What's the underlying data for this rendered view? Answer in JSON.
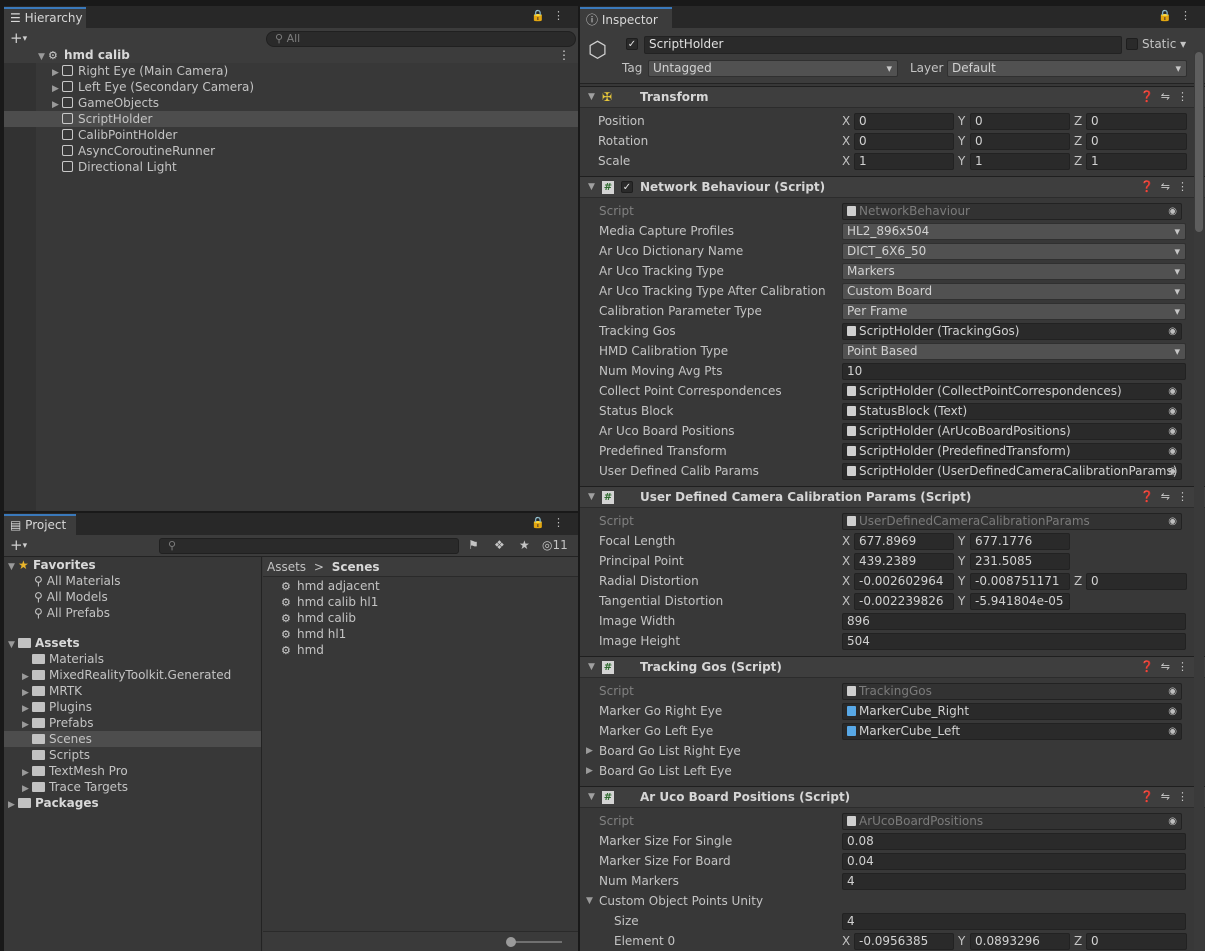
{
  "hierarchy": {
    "tab_label": "Hierarchy",
    "search_placeholder": "All",
    "scene_name": "hmd calib",
    "items": [
      {
        "label": "Right Eye (Main Camera)",
        "expandable": true
      },
      {
        "label": "Left Eye (Secondary Camera)",
        "expandable": true
      },
      {
        "label": "GameObjects",
        "expandable": true
      },
      {
        "label": "ScriptHolder",
        "expandable": false,
        "selected": true
      },
      {
        "label": "CalibPointHolder",
        "expandable": false
      },
      {
        "label": "AsyncCoroutineRunner",
        "expandable": false
      },
      {
        "label": "Directional Light",
        "expandable": false
      }
    ]
  },
  "project": {
    "tab_label": "Project",
    "hidden_count": "11",
    "favorites_label": "Favorites",
    "favorites": [
      "All Materials",
      "All Models",
      "All Prefabs"
    ],
    "assets_label": "Assets",
    "assets": [
      {
        "label": "Materials",
        "expandable": false
      },
      {
        "label": "MixedRealityToolkit.Generated",
        "expandable": true
      },
      {
        "label": "MRTK",
        "expandable": true
      },
      {
        "label": "Plugins",
        "expandable": true
      },
      {
        "label": "Prefabs",
        "expandable": true
      },
      {
        "label": "Scenes",
        "expandable": false,
        "selected": true
      },
      {
        "label": "Scripts",
        "expandable": false
      },
      {
        "label": "TextMesh Pro",
        "expandable": true
      },
      {
        "label": "Trace Targets",
        "expandable": true
      }
    ],
    "packages_label": "Packages",
    "breadcrumb": {
      "root": "Assets",
      "sep": ">",
      "current": "Scenes"
    },
    "files": [
      "hmd adjacent",
      "hmd calib hl1",
      "hmd calib",
      "hmd hl1",
      "hmd"
    ]
  },
  "inspector": {
    "tab_label": "Inspector",
    "object_name": "ScriptHolder",
    "static_label": "Static",
    "tag_label": "Tag",
    "tag_value": "Untagged",
    "layer_label": "Layer",
    "layer_value": "Default",
    "transform": {
      "title": "Transform",
      "rows": [
        {
          "label": "Position",
          "x": "0",
          "y": "0",
          "z": "0"
        },
        {
          "label": "Rotation",
          "x": "0",
          "y": "0",
          "z": "0"
        },
        {
          "label": "Scale",
          "x": "1",
          "y": "1",
          "z": "1"
        }
      ]
    },
    "network": {
      "title": "Network Behaviour (Script)",
      "rows": [
        {
          "label": "Script",
          "value": "NetworkBehaviour",
          "kind": "script"
        },
        {
          "label": "Media Capture Profiles",
          "value": "HL2_896x504",
          "kind": "dropdown"
        },
        {
          "label": "Ar Uco Dictionary Name",
          "value": "DICT_6X6_50",
          "kind": "dropdown"
        },
        {
          "label": "Ar Uco Tracking Type",
          "value": "Markers",
          "kind": "dropdown"
        },
        {
          "label": "Ar Uco Tracking Type After Calibration",
          "value": "Custom Board",
          "kind": "dropdown"
        },
        {
          "label": "Calibration Parameter Type",
          "value": "Per Frame",
          "kind": "dropdown"
        },
        {
          "label": "Tracking Gos",
          "value": "ScriptHolder (TrackingGos)",
          "kind": "object"
        },
        {
          "label": "HMD Calibration Type",
          "value": "Point Based",
          "kind": "dropdown"
        },
        {
          "label": "Num Moving Avg Pts",
          "value": "10",
          "kind": "text"
        },
        {
          "label": "Collect Point Correspondences",
          "value": "ScriptHolder (CollectPointCorrespondences)",
          "kind": "object"
        },
        {
          "label": "Status Block",
          "value": "StatusBlock (Text)",
          "kind": "object-text"
        },
        {
          "label": "Ar Uco Board Positions",
          "value": "ScriptHolder (ArUcoBoardPositions)",
          "kind": "object"
        },
        {
          "label": "Predefined Transform",
          "value": "ScriptHolder (PredefinedTransform)",
          "kind": "object"
        },
        {
          "label": "User Defined Calib Params",
          "value": "ScriptHolder (UserDefinedCameraCalibrationParams)",
          "kind": "object"
        }
      ]
    },
    "calib": {
      "title": "User Defined Camera Calibration Params (Script)",
      "script_label": "Script",
      "script_value": "UserDefinedCameraCalibrationParams",
      "focal": {
        "label": "Focal Length",
        "x": "677.8969",
        "y": "677.1776"
      },
      "principal": {
        "label": "Principal Point",
        "x": "439.2389",
        "y": "231.5085"
      },
      "radial": {
        "label": "Radial Distortion",
        "x": "-0.002602964",
        "y": "-0.008751171",
        "z": "0"
      },
      "tangential": {
        "label": "Tangential Distortion",
        "x": "-0.002239826",
        "y": "-5.941804e-05"
      },
      "width": {
        "label": "Image Width",
        "value": "896"
      },
      "height": {
        "label": "Image Height",
        "value": "504"
      }
    },
    "tracking": {
      "title": "Tracking Gos (Script)",
      "script_label": "Script",
      "script_value": "TrackingGos",
      "right_label": "Marker Go Right Eye",
      "right_value": "MarkerCube_Right",
      "left_label": "Marker Go Left Eye",
      "left_value": "MarkerCube_Left",
      "list_right": "Board Go List Right Eye",
      "list_left": "Board Go List Left Eye"
    },
    "board": {
      "title": "Ar Uco Board Positions (Script)",
      "script_label": "Script",
      "script_value": "ArUcoBoardPositions",
      "single_label": "Marker Size For Single",
      "single_value": "0.08",
      "board_label": "Marker Size For Board",
      "board_value": "0.04",
      "num_label": "Num Markers",
      "num_value": "4",
      "custom_label": "Custom Object Points Unity",
      "size_label": "Size",
      "size_value": "4",
      "el0_label": "Element 0",
      "el0_x": "-0.0956385",
      "el0_y": "0.0893296",
      "el0_z": "0"
    }
  },
  "axes": {
    "x": "X",
    "y": "Y",
    "z": "Z"
  }
}
